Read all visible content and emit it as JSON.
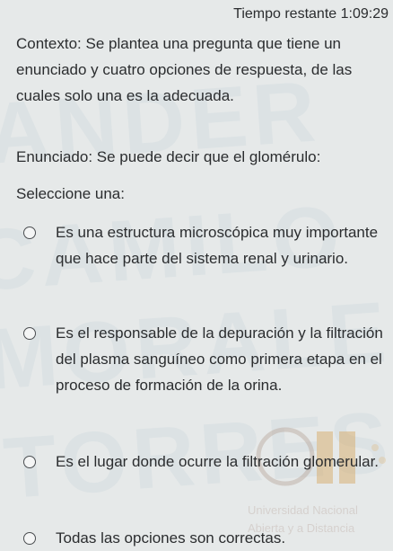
{
  "timer": {
    "label": "Tiempo restante",
    "value": "1:09:29"
  },
  "question": {
    "context": "Contexto: Se plantea una pregunta que tiene un enunciado y cuatro opciones de respuesta, de las cuales solo una es la adecuada.",
    "statement": "Enunciado: Se puede decir que el glomérulo:",
    "prompt": "Seleccione una:"
  },
  "options": [
    {
      "text": "Es una estructura microscópica muy importante que hace parte del sistema renal y urinario."
    },
    {
      "text": "Es el responsable de la depuración y la filtración del plasma sanguíneo como primera etapa en el proceso de formación de la orina."
    },
    {
      "text": "Es el lugar donde ocurre la filtración glomerular."
    },
    {
      "text": "Todas las opciones son correctas."
    }
  ],
  "watermark": {
    "words": [
      "ANDER",
      "CAMILO",
      "MORALES",
      "TORRES"
    ],
    "logo_line1": "Universidad Nacional",
    "logo_line2": "Abierta y a Distancia"
  }
}
